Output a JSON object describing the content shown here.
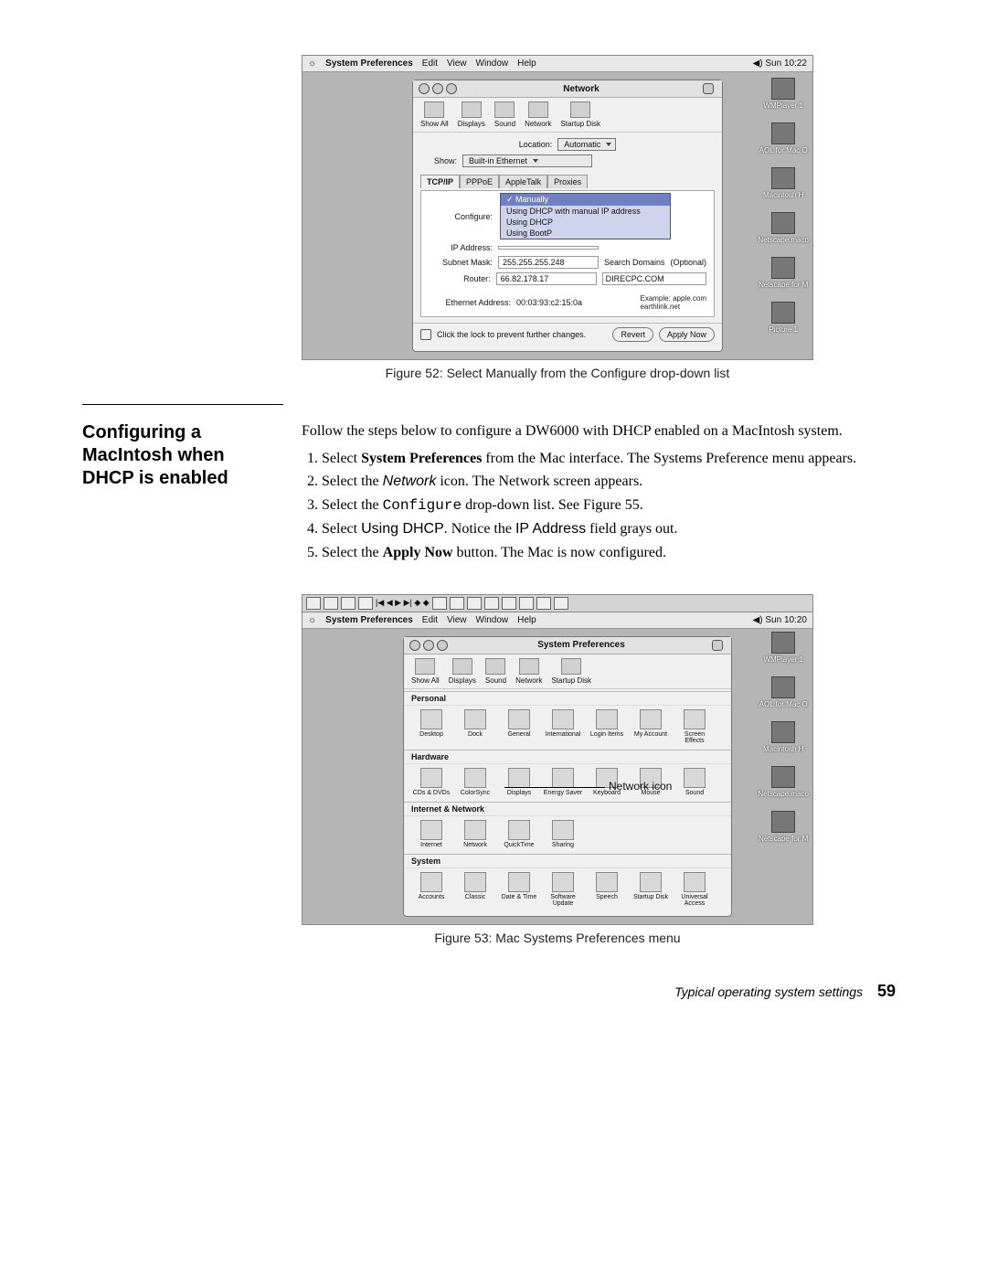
{
  "fig52": {
    "menubar": {
      "apple": "⌘",
      "app": "System Preferences",
      "items": [
        "Edit",
        "View",
        "Window",
        "Help"
      ],
      "clock": "Sun 10:22"
    },
    "window": {
      "title": "Network",
      "toolbar": [
        "Show All",
        "Displays",
        "Sound",
        "Network",
        "Startup Disk"
      ],
      "location_label": "Location:",
      "location_value": "Automatic",
      "show_label": "Show:",
      "show_value": "Built-in Ethernet",
      "tabs": [
        "TCP/IP",
        "PPPoE",
        "AppleTalk",
        "Proxies"
      ],
      "configure_label": "Configure:",
      "configure_options": [
        "Manually",
        "Using DHCP with manual IP address",
        "Using DHCP",
        "Using BootP"
      ],
      "ip_label": "IP Address:",
      "subnet_label": "Subnet Mask:",
      "subnet_value": "255.255.255.248",
      "router_label": "Router:",
      "router_value": "66.82.178.17",
      "search_label": "Search Domains",
      "optional": "(Optional)",
      "search_value": "DIRECPC.COM",
      "ether_label": "Ethernet Address:",
      "ether_value": "00:03:93:c2:15:0a",
      "example_label": "Example:",
      "example_value": "apple.com\nearthlink.net",
      "lock_text": "Click the lock to prevent further changes.",
      "revert": "Revert",
      "apply": "Apply Now"
    },
    "desktop_icons": [
      "WMPlayer 1",
      "AOL for Mac O",
      "Macintosh H",
      "Netscape.maco",
      "Netscape for M",
      "Picture 1"
    ],
    "caption": "Figure 52:  Select Manually from the Configure drop-down list"
  },
  "section": {
    "heading": "Configuring a MacIntosh when DHCP is enabled",
    "intro": "Follow the steps below to configure a DW6000 with DHCP enabled on a MacIntosh system.",
    "steps": [
      {
        "pre": "Select ",
        "bold": "System Preferences",
        "post": " from the Mac interface. The Systems Preference menu appears."
      },
      {
        "pre": "Select the ",
        "ital": "Network",
        "post": " icon. The Network screen appears."
      },
      {
        "pre": "Select the ",
        "mono": "Configure",
        "post": " drop-down list. See Figure 55."
      },
      {
        "pre": "Select ",
        "sans": "Using DHCP",
        "mid": ". Notice the ",
        "sans2": "IP Address",
        "post": " field grays out."
      },
      {
        "pre": "Select the ",
        "bold": "Apply Now",
        "post": " button. The Mac is now configured."
      }
    ]
  },
  "fig53": {
    "menubar": {
      "apple": "⌘",
      "app": "System Preferences",
      "items": [
        "Edit",
        "View",
        "Window",
        "Help"
      ],
      "clock": "Sun 10:20"
    },
    "title": "System Preferences",
    "toolbar": [
      "Show All",
      "Displays",
      "Sound",
      "Network",
      "Startup Disk"
    ],
    "cats": {
      "Personal": [
        "Desktop",
        "Dock",
        "General",
        "International",
        "Login Items",
        "My Account",
        "Screen Effects"
      ],
      "Hardware": [
        "CDs & DVDs",
        "ColorSync",
        "Displays",
        "Energy Saver",
        "Keyboard",
        "Mouse",
        "Sound"
      ],
      "Internet & Network": [
        "Internet",
        "Network",
        "QuickTime",
        "Sharing"
      ],
      "System": [
        "Accounts",
        "Classic",
        "Date & Time",
        "Software Update",
        "Speech",
        "Startup Disk",
        "Universal Access"
      ]
    },
    "callout": "Network icon",
    "desktop_icons": [
      "WMPlayer 1",
      "AOL for Mac O",
      "Macintosh H",
      "Netscape.maco",
      "Netscape for M"
    ],
    "caption": "Figure 53:  Mac Systems Preferences menu"
  },
  "footer": {
    "text": "Typical operating system settings",
    "page": "59"
  }
}
